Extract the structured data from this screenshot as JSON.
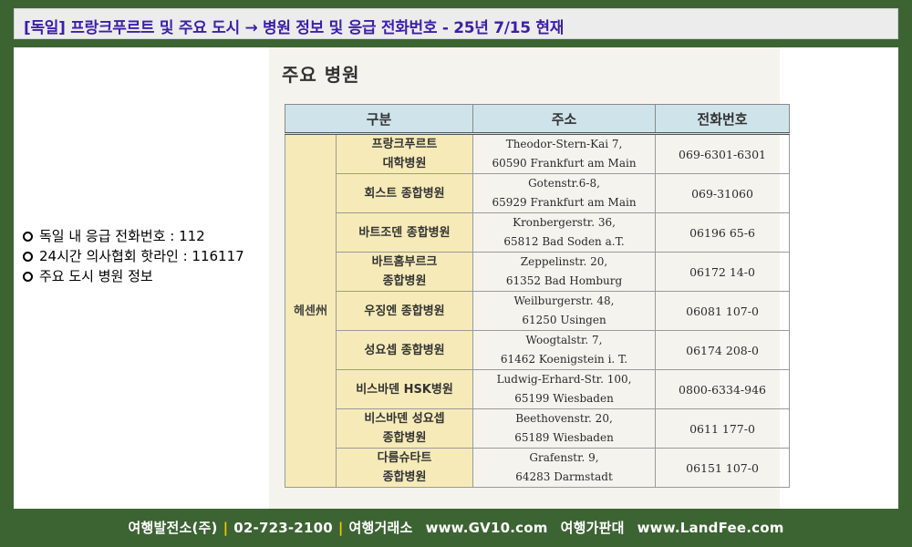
{
  "title": "[독일] 프랑크푸르트 및 주요 도시  →  병원 정보 및 응급 전화번호 - 25년 7/15 현재",
  "bullets": [
    "독일 내 응급 전화번호 : 112",
    "24시간 의사협회 핫라인 : 116117",
    "주요 도시 병원 정보"
  ],
  "section_heading": "주요 병원",
  "table": {
    "headers": [
      "구분",
      "주소",
      "전화번호"
    ],
    "region": "헤센州",
    "rows": [
      {
        "name": [
          "프랑크푸르트",
          "대학병원"
        ],
        "address": [
          "Theodor-Stern-Kai 7,",
          "60590 Frankfurt am Main"
        ],
        "phone": "069-6301-6301"
      },
      {
        "name": [
          "회스트 종합병원"
        ],
        "address": [
          "Gotenstr.6-8,",
          "65929 Frankfurt am Main"
        ],
        "phone": "069-31060"
      },
      {
        "name": [
          "바트조덴 종합병원"
        ],
        "address": [
          "Kronbergerstr. 36,",
          "65812 Bad Soden a.T."
        ],
        "phone": "06196 65-6"
      },
      {
        "name": [
          "바트홈부르크",
          "종합병원"
        ],
        "address": [
          "Zeppelinstr. 20,",
          "61352 Bad Homburg"
        ],
        "phone": "06172 14-0"
      },
      {
        "name": [
          "우징엔 종합병원"
        ],
        "address": [
          "Weilburgerstr. 48,",
          "61250 Usingen"
        ],
        "phone": "06081 107-0"
      },
      {
        "name": [
          "성요셉 종합병원"
        ],
        "address": [
          "Woogtalstr. 7,",
          "61462 Koenigstein i. T."
        ],
        "phone": "06174 208-0"
      },
      {
        "name": [
          "비스바덴 HSK병원"
        ],
        "address": [
          "Ludwig-Erhard-Str. 100,",
          "65199 Wiesbaden"
        ],
        "phone": "0800-6334-946"
      },
      {
        "name": [
          "비스바덴 성요셉",
          "종합병원"
        ],
        "address": [
          "Beethovenstr. 20,",
          "65189 Wiesbaden"
        ],
        "phone": "0611 177-0"
      },
      {
        "name": [
          "다름슈타트",
          "종합병원"
        ],
        "address": [
          "Grafenstr. 9,",
          "64283 Darmstadt"
        ],
        "phone": "06151 107-0"
      }
    ]
  },
  "footer": {
    "company": "여행발전소(주)",
    "phone": "02-723-2100",
    "label1": "여행거래소",
    "site1": "www.GV10.com",
    "label2": "여행가판대",
    "site2": "www.LandFee.com"
  }
}
